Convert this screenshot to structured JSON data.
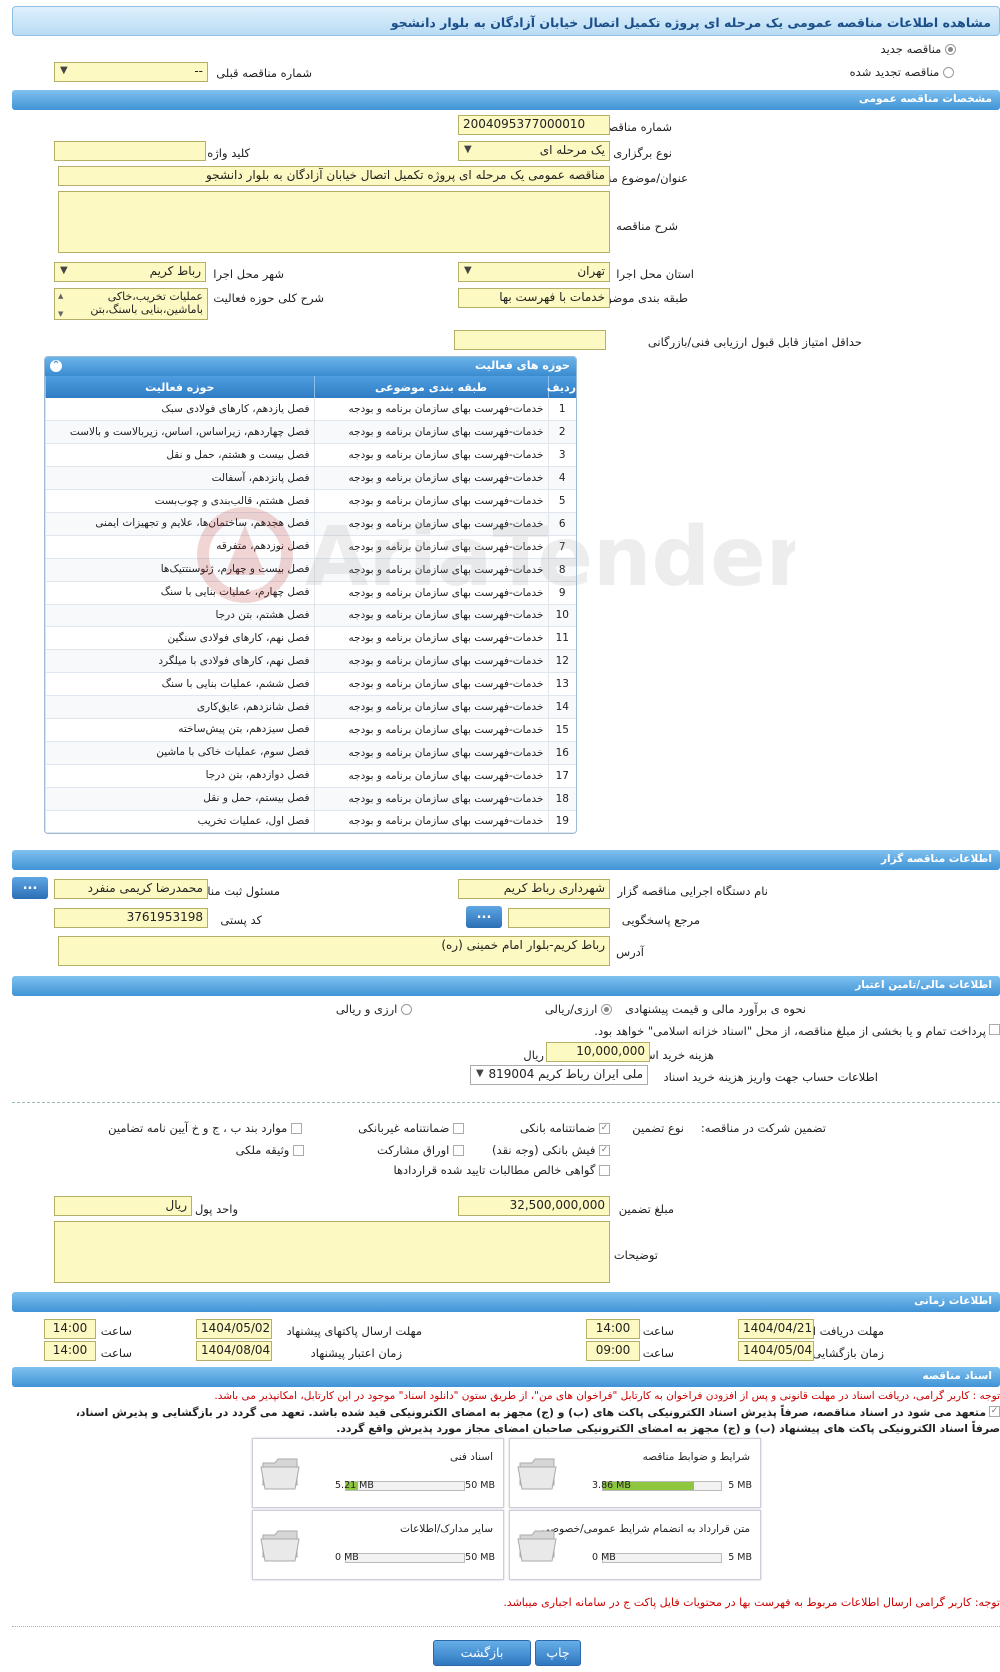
{
  "page_title": "مشاهده اطلاعات مناقصه عمومی یک مرحله ای پروژه تکمیل اتصال خیابان آزادگان به بلوار دانشجو",
  "top": {
    "radio_new": "مناقصه جدید",
    "radio_renewed": "مناقصه تجدید شده",
    "prev_tender_label": "شماره مناقصه قبلی",
    "prev_tender_value": "--"
  },
  "general": {
    "section_title": "مشخصات مناقصه عمومی",
    "tender_number_label": "شماره مناقصه",
    "tender_number": "2004095377000010",
    "type_label": "نوع برگزاری",
    "type_value": "یک مرحله ای",
    "keyword_label": "کلید واژه",
    "keyword_value": "",
    "subject_label": "عنوان/موضوع مناقصه",
    "subject_value": "مناقصه عمومی یک مرحله ای پروژه تکمیل اتصال خیابان آزادگان به بلوار دانشجو",
    "description_label": "شرح مناقصه",
    "description_value": "",
    "province_label": "استان محل اجرا",
    "province_value": "تهران",
    "city_label": "شهر محل اجرا",
    "city_value": "رباط کریم",
    "category_label": "طبقه بندی موضوعی",
    "category_value": "خدمات با فهرست بها",
    "activity_desc_label": "شرح کلی حوزه فعالیت",
    "activity_desc_value": "عملیات تخریب،خاکی باماشین،بنایی باسنگ،بتن",
    "min_score_label": "حداقل امتیاز قابل قبول ارزیابی فنی/بازرگانی",
    "min_score_value": ""
  },
  "activities": {
    "title": "حوزه های فعالیت",
    "col_idx": "ردیف",
    "col_category": "طبقه بندی موضوعی",
    "col_activity": "حوزه فعالیت",
    "rows": [
      {
        "idx": "1",
        "category": "خدمات-فهرست بهای سازمان برنامه و بودجه",
        "activity": "فصل یازدهم، کارهای فولادی سبک"
      },
      {
        "idx": "2",
        "category": "خدمات-فهرست بهای سازمان برنامه و بودجه",
        "activity": "فصل چهاردهم، زیراساس، اساس، زیربالاست و بالاست"
      },
      {
        "idx": "3",
        "category": "خدمات-فهرست بهای سازمان برنامه و بودجه",
        "activity": "فصل بیست و هشتم، حمل و نقل"
      },
      {
        "idx": "4",
        "category": "خدمات-فهرست بهای سازمان برنامه و بودجه",
        "activity": "فصل پانزدهم، آسفالت"
      },
      {
        "idx": "5",
        "category": "خدمات-فهرست بهای سازمان برنامه و بودجه",
        "activity": "فصل هشتم، قالب‌بندی و چوب‌بست"
      },
      {
        "idx": "6",
        "category": "خدمات-فهرست بهای سازمان برنامه و بودجه",
        "activity": "فصل هجدهم، ساختمان‌ها، علایم و تجهیزات ایمنی"
      },
      {
        "idx": "7",
        "category": "خدمات-فهرست بهای سازمان برنامه و بودجه",
        "activity": "فصل نوزدهم، متفرقه"
      },
      {
        "idx": "8",
        "category": "خدمات-فهرست بهای سازمان برنامه و بودجه",
        "activity": "فصل بیست و چهارم، ژئوسنتتیک‌ها"
      },
      {
        "idx": "9",
        "category": "خدمات-فهرست بهای سازمان برنامه و بودجه",
        "activity": "فصل چهارم، عملیات بنایی با سنگ"
      },
      {
        "idx": "10",
        "category": "خدمات-فهرست بهای سازمان برنامه و بودجه",
        "activity": "فصل هشتم، بتن درجا"
      },
      {
        "idx": "11",
        "category": "خدمات-فهرست بهای سازمان برنامه و بودجه",
        "activity": "فصل نهم، کارهای فولادی سنگین"
      },
      {
        "idx": "12",
        "category": "خدمات-فهرست بهای سازمان برنامه و بودجه",
        "activity": "فصل نهم، کارهای فولادی با میلگرد"
      },
      {
        "idx": "13",
        "category": "خدمات-فهرست بهای سازمان برنامه و بودجه",
        "activity": "فصل ششم، عملیات بنایی با سنگ"
      },
      {
        "idx": "14",
        "category": "خدمات-فهرست بهای سازمان برنامه و بودجه",
        "activity": "فصل شانزدهم، عایق‌کاری"
      },
      {
        "idx": "15",
        "category": "خدمات-فهرست بهای سازمان برنامه و بودجه",
        "activity": "فصل سیزدهم، بتن پیش‌ساخته"
      },
      {
        "idx": "16",
        "category": "خدمات-فهرست بهای سازمان برنامه و بودجه",
        "activity": "فصل سوم، عملیات خاکی با ماشین"
      },
      {
        "idx": "17",
        "category": "خدمات-فهرست بهای سازمان برنامه و بودجه",
        "activity": "فصل دوازدهم، بتن درجا"
      },
      {
        "idx": "18",
        "category": "خدمات-فهرست بهای سازمان برنامه و بودجه",
        "activity": "فصل بیستم، حمل و نقل"
      },
      {
        "idx": "19",
        "category": "خدمات-فهرست بهای سازمان برنامه و بودجه",
        "activity": "فصل اول، عملیات تخریب"
      }
    ]
  },
  "watermark": "AriaTender.neT",
  "organizer": {
    "section_title": "اطلاعات مناقصه گزار",
    "agency_label": "نام دستگاه اجرایی مناقصه گزار",
    "agency_value": "شهرداری رباط کریم",
    "registrar_label": "مسئول ثبت مناقصه",
    "registrar_value": "محمدرضا کریمی منفرد",
    "dots": "...",
    "ref_label": "مرجع پاسخگویی",
    "ref_value": "",
    "postal_label": "کد پستی",
    "postal_value": "3761953198",
    "address_label": "آدرس",
    "address_value": "رباط کریم-بلوار امام خمینی (ره)"
  },
  "finance": {
    "section_title": "اطلاعات مالی/تامین اعتبار",
    "estimate_label": "نحوه ی برآورد مالی و قیمت پیشنهادی",
    "opt_rial": "ارزی/ریالی",
    "opt_fx_rial": "ارزی و ریالی",
    "payment_note": "پرداخت تمام و یا بخشی از مبلغ مناقصه، از محل \"اسناد خزانه اسلامی\" خواهد بود.",
    "doc_fee_label": "هزینه خرید اسناد",
    "doc_fee_value": "10,000,000",
    "doc_fee_unit": "ریال",
    "account_label": "اطلاعات حساب جهت واریز هزینه خرید اسناد",
    "account_value": "ملی ایران رباط کریم 819004"
  },
  "guarantee": {
    "title": "تضمین شرکت در مناقصه:",
    "type_label": "نوع تضمین",
    "bank_guarantee": "ضمانتنامه بانکی",
    "nonbank_guarantee": "ضمانتنامه غیربانکی",
    "clause": "موارد بند ب ، ج و خ آیین نامه تضامین",
    "cash_check": "فیش بانکی (وجه نقد)",
    "bonds": "اوراق مشارکت",
    "property": "وثیقه ملکی",
    "receivables": "گواهی خالص مطالبات تایید شده قراردادها",
    "amount_label": "مبلغ تضمین",
    "amount_value": "32,500,000,000",
    "currency_label": "واحد پول",
    "currency_value": "ریال",
    "notes_label": "توضیحات",
    "notes_value": ""
  },
  "timing": {
    "section_title": "اطلاعات زمانی",
    "doc_deadline_label": "مهلت دریافت اسناد",
    "doc_deadline_date": "1404/04/21",
    "doc_deadline_time": "14:00",
    "submit_deadline_label": "مهلت ارسال پاکتهای پیشنهاد",
    "submit_deadline_date": "1404/05/02",
    "submit_deadline_time": "14:00",
    "opening_label": "زمان بازگشایی پاکت ها",
    "opening_date": "1404/05/04",
    "opening_time": "09:00",
    "validity_label": "زمان اعتبار پیشنهاد",
    "validity_date": "1404/08/04",
    "validity_time": "14:00",
    "time_label": "ساعت"
  },
  "documents": {
    "section_title": "اسناد مناقصه",
    "note1": "توجه : کاربر گرامی، دریافت اسناد در مهلت قانونی و پس از افزودن فراخوان به کارتابل \"فراخوان های من\"، از طریق ستون \"دانلود اسناد\" موجود در این کارتابل، امکانپذیر می باشد.",
    "note2": "متعهد می شود در اسناد مناقصه، صرفاً پذیرش اسناد الکترونیکی پاکت های (ب) و (ج) مجهز به امضای الکترونیکی قید شده باشد. تعهد می گردد در بازگشایی و پذیرش اسناد،",
    "note3": "صرفاً اسناد الکترونیکی پاکت های پیشنهاد (ب) و (ج) مجهز به امضای الکترونیکی صاحبان امضای مجاز مورد پذیرش واقع گردد.",
    "files": [
      {
        "name": "شرایط و ضوابط مناقصه",
        "used": "3.86 MB",
        "max": "5 MB",
        "fraction": 0.772
      },
      {
        "name": "اسناد فنی",
        "used": "5.21 MB",
        "max": "50 MB",
        "fraction": 0.104
      },
      {
        "name": "متن قرارداد به انضمام شرایط عمومی/خصوصی",
        "used": "0 MB",
        "max": "5 MB",
        "fraction": 0
      },
      {
        "name": "سایر مدارک/اطلاعات",
        "used": "0 MB",
        "max": "50 MB",
        "fraction": 0
      }
    ],
    "note4": "توجه: کاربر گرامی ارسال اطلاعات مربوط به فهرست بها در محتویات فایل پاکت ج در سامانه اجباری میباشد."
  },
  "buttons": {
    "back": "بازگشت",
    "print": "چاپ"
  }
}
